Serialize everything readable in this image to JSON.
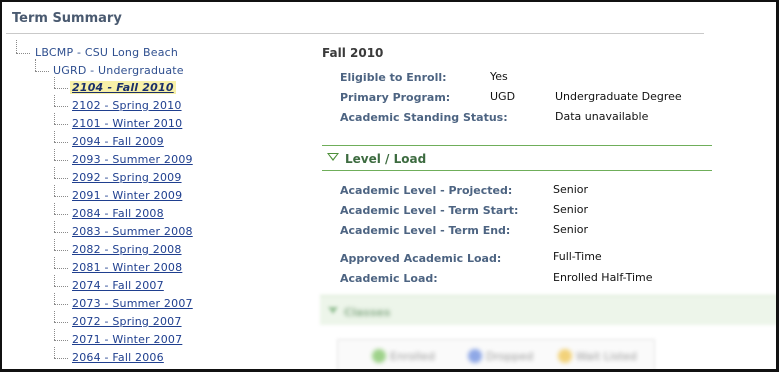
{
  "page": {
    "title": "Term Summary"
  },
  "tree": {
    "institution": "LBCMP - CSU Long Beach",
    "career": "UGRD - Undergraduate",
    "terms": [
      {
        "label": "2104 - Fall 2010",
        "selected": true
      },
      {
        "label": "2102 - Spring 2010",
        "selected": false
      },
      {
        "label": "2101 - Winter 2010",
        "selected": false
      },
      {
        "label": "2094 - Fall 2009",
        "selected": false
      },
      {
        "label": "2093 - Summer 2009",
        "selected": false
      },
      {
        "label": "2092 - Spring 2009",
        "selected": false
      },
      {
        "label": "2091 - Winter 2009",
        "selected": false
      },
      {
        "label": "2084 - Fall 2008",
        "selected": false
      },
      {
        "label": "2083 - Summer 2008",
        "selected": false
      },
      {
        "label": "2082 - Spring 2008",
        "selected": false
      },
      {
        "label": "2081 - Winter 2008",
        "selected": false
      },
      {
        "label": "2074 - Fall 2007",
        "selected": false
      },
      {
        "label": "2073 - Summer 2007",
        "selected": false
      },
      {
        "label": "2072 - Spring 2007",
        "selected": false
      },
      {
        "label": "2071 - Winter 2007",
        "selected": false
      },
      {
        "label": "2064 - Fall 2006",
        "selected": false
      }
    ]
  },
  "detail": {
    "term_title": "Fall 2010",
    "eligible_label": "Eligible to Enroll:",
    "eligible_value": "Yes",
    "program_label": "Primary Program:",
    "program_code": "UGD",
    "program_name": "Undergraduate Degree",
    "standing_label": "Academic Standing Status:",
    "standing_value": "Data unavailable"
  },
  "level_load": {
    "section_title": "Level / Load",
    "projected_label": "Academic Level - Projected:",
    "projected_value": "Senior",
    "term_start_label": "Academic Level - Term Start:",
    "term_start_value": "Senior",
    "term_end_label": "Academic Level - Term End:",
    "term_end_value": "Senior",
    "approved_load_label": "Approved Academic Load:",
    "approved_load_value": "Full-Time",
    "load_label": "Academic Load:",
    "load_value": "Enrolled Half-Time"
  },
  "blurred": {
    "section_title": "Classes",
    "buttons": [
      "Enrolled",
      "Dropped",
      "Wait Listed"
    ]
  },
  "colors": {
    "label_blue": "#4d6482",
    "link_blue": "#1f3f8f",
    "selected_highlight": "#f7f0a8",
    "section_green": "#4e8f3a"
  }
}
